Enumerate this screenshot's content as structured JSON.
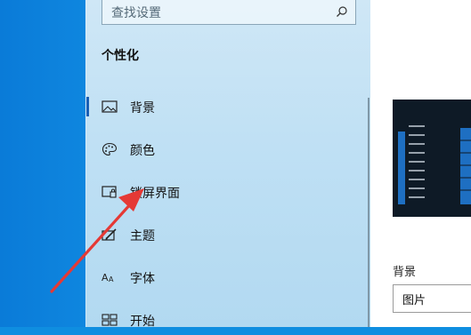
{
  "search": {
    "placeholder": "查找设置"
  },
  "section_title": "个性化",
  "nav": {
    "items": [
      {
        "label": "背景",
        "icon": "picture-icon",
        "active": true
      },
      {
        "label": "颜色",
        "icon": "palette-icon",
        "active": false
      },
      {
        "label": "锁屏界面",
        "icon": "lock-screen-icon",
        "active": false
      },
      {
        "label": "主题",
        "icon": "theme-brush-icon",
        "active": false
      },
      {
        "label": "字体",
        "icon": "font-icon",
        "active": false
      },
      {
        "label": "开始",
        "icon": "start-grid-icon",
        "active": false
      }
    ]
  },
  "preview": {
    "background_label": "背景",
    "background_select_value": "图片"
  },
  "colors": {
    "accent": "#1a5fb4",
    "annotation_arrow": "#e53935"
  }
}
